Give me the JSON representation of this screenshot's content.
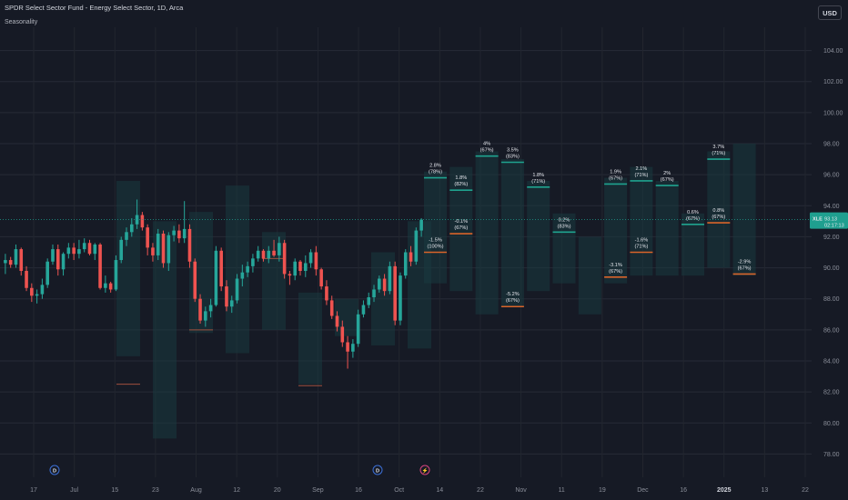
{
  "header": {
    "title": "SPDR Select Sector Fund - Energy Select Sector, 1D, Arca",
    "indicator": "Seasonality",
    "currency": "USD"
  },
  "colors": {
    "up": "#26a69a",
    "down": "#ef5350",
    "future_up": "#1fa38f",
    "future_down": "#d9642a",
    "band": "#1a3a40",
    "past_line": "#a1503e",
    "price_label_bg": "#1f9f8f"
  },
  "price_label": {
    "ticker": "XLE",
    "price": "93.13",
    "countdown": "02:17:13"
  },
  "event_markers": [
    {
      "label": "D",
      "kind": "dividend-icon"
    },
    {
      "label": "D",
      "kind": "dividend-icon"
    },
    {
      "label": "⚡",
      "kind": "earnings-icon"
    }
  ],
  "chart_data": {
    "type": "candlestick",
    "title": "SPDR Select Sector Fund - Energy Select Sector, 1D, Arca",
    "ylim": [
      76.5,
      105.5
    ],
    "y_ticks": [
      "78.00",
      "80.00",
      "82.00",
      "84.00",
      "86.00",
      "88.00",
      "90.00",
      "92.00",
      "94.00",
      "96.00",
      "98.00",
      "100.00",
      "102.00",
      "104.00"
    ],
    "x_ticks": [
      "17",
      "Jul",
      "15",
      "23",
      "Aug",
      "12",
      "20",
      "Sep",
      "16",
      "Oct",
      "14",
      "22",
      "Nov",
      "11",
      "19",
      "Dec",
      "16",
      "2025",
      "13",
      "22"
    ],
    "x_tick_bold": "2025",
    "grid": true,
    "candles": [
      [
        90.3,
        90.9,
        89.6,
        90.5
      ],
      [
        90.5,
        90.7,
        90.0,
        90.2
      ],
      [
        90.2,
        91.5,
        90.0,
        91.2
      ],
      [
        91.2,
        91.3,
        89.5,
        89.8
      ],
      [
        89.8,
        90.1,
        88.5,
        88.7
      ],
      [
        88.7,
        89.0,
        87.8,
        88.2
      ],
      [
        88.2,
        88.6,
        87.7,
        88.3
      ],
      [
        88.3,
        89.3,
        88.0,
        88.9
      ],
      [
        88.9,
        90.6,
        88.7,
        90.4
      ],
      [
        90.4,
        91.5,
        90.2,
        91.2
      ],
      [
        91.2,
        91.5,
        89.5,
        89.9
      ],
      [
        89.9,
        91.0,
        89.5,
        90.9
      ],
      [
        90.9,
        91.6,
        90.6,
        91.3
      ],
      [
        91.3,
        91.6,
        90.5,
        90.9
      ],
      [
        90.9,
        91.8,
        90.6,
        91.2
      ],
      [
        91.2,
        91.9,
        91.0,
        91.6
      ],
      [
        91.6,
        91.8,
        90.8,
        90.9
      ],
      [
        90.9,
        91.6,
        90.5,
        91.5
      ],
      [
        91.5,
        91.6,
        88.6,
        88.7
      ],
      [
        88.7,
        89.5,
        88.4,
        89.0
      ],
      [
        89.0,
        89.1,
        88.4,
        88.6
      ],
      [
        88.6,
        90.8,
        88.5,
        90.5
      ],
      [
        90.5,
        92.0,
        90.3,
        91.8
      ],
      [
        91.8,
        92.6,
        91.4,
        92.3
      ],
      [
        92.3,
        93.2,
        92.0,
        92.8
      ],
      [
        92.8,
        94.4,
        92.5,
        93.4
      ],
      [
        93.4,
        93.6,
        92.4,
        92.6
      ],
      [
        92.6,
        92.8,
        90.8,
        91.3
      ],
      [
        91.3,
        91.6,
        90.4,
        90.8
      ],
      [
        90.8,
        92.5,
        90.5,
        92.2
      ],
      [
        92.2,
        92.4,
        90.0,
        90.3
      ],
      [
        90.3,
        92.3,
        89.8,
        92.1
      ],
      [
        92.1,
        92.7,
        91.7,
        92.4
      ],
      [
        92.4,
        92.8,
        91.6,
        91.9
      ],
      [
        91.9,
        94.3,
        91.6,
        92.5
      ],
      [
        92.5,
        92.8,
        90.0,
        90.4
      ],
      [
        90.4,
        90.6,
        87.8,
        88.0
      ],
      [
        88.0,
        88.3,
        86.4,
        86.6
      ],
      [
        86.6,
        87.5,
        86.2,
        87.2
      ],
      [
        87.2,
        88.0,
        86.8,
        87.6
      ],
      [
        87.6,
        91.4,
        87.5,
        91.1
      ],
      [
        91.1,
        91.3,
        88.5,
        88.8
      ],
      [
        88.8,
        89.2,
        87.2,
        87.5
      ],
      [
        87.5,
        88.2,
        87.1,
        87.9
      ],
      [
        87.9,
        89.6,
        87.7,
        89.3
      ],
      [
        89.3,
        90.2,
        88.8,
        89.7
      ],
      [
        89.7,
        90.4,
        89.4,
        90.1
      ],
      [
        90.1,
        90.9,
        89.7,
        90.6
      ],
      [
        90.6,
        91.4,
        90.4,
        91.1
      ],
      [
        91.1,
        91.2,
        90.4,
        90.6
      ],
      [
        90.6,
        91.4,
        90.3,
        91.1
      ],
      [
        91.1,
        91.8,
        90.7,
        90.8
      ],
      [
        90.8,
        92.0,
        90.4,
        91.6
      ],
      [
        91.6,
        91.8,
        89.3,
        89.6
      ],
      [
        89.6,
        89.8,
        88.9,
        89.5
      ],
      [
        89.5,
        90.6,
        89.2,
        90.4
      ],
      [
        90.4,
        90.5,
        89.5,
        89.8
      ],
      [
        89.8,
        90.8,
        89.4,
        90.3
      ],
      [
        90.3,
        91.2,
        90.0,
        91.0
      ],
      [
        91.0,
        91.4,
        89.5,
        89.9
      ],
      [
        89.9,
        90.0,
        88.6,
        88.8
      ],
      [
        88.8,
        89.2,
        87.6,
        87.9
      ],
      [
        87.9,
        88.2,
        86.7,
        86.9
      ],
      [
        86.9,
        87.2,
        85.9,
        86.2
      ],
      [
        86.2,
        86.6,
        84.9,
        85.2
      ],
      [
        85.2,
        85.6,
        83.5,
        84.6
      ],
      [
        84.6,
        85.4,
        84.2,
        85.1
      ],
      [
        85.1,
        87.3,
        84.9,
        87.0
      ],
      [
        87.0,
        87.9,
        86.8,
        87.6
      ],
      [
        87.6,
        88.4,
        87.4,
        88.1
      ],
      [
        88.1,
        88.9,
        87.8,
        88.6
      ],
      [
        88.6,
        89.5,
        88.4,
        89.3
      ],
      [
        89.3,
        89.6,
        88.2,
        88.5
      ],
      [
        88.5,
        90.4,
        88.3,
        90.1
      ],
      [
        90.1,
        90.4,
        86.3,
        86.6
      ],
      [
        86.6,
        89.7,
        86.3,
        89.5
      ],
      [
        89.5,
        91.2,
        89.3,
        91.0
      ],
      [
        91.0,
        91.4,
        90.1,
        90.4
      ],
      [
        90.4,
        92.6,
        90.2,
        92.4
      ],
      [
        92.4,
        93.2,
        92.0,
        93.1
      ]
    ],
    "future_candles": [
      [
        87.8,
        88.6,
        87.2,
        88.2
      ],
      [
        86.1,
        86.5,
        84.9,
        85.4
      ],
      [
        88.0,
        89.8,
        86.7,
        88.9
      ]
    ],
    "seasonal_bars": [
      {
        "low": 84.3,
        "high": 95.6,
        "base": 82.5,
        "up": false
      },
      {
        "low": 79.0,
        "high": 93.0,
        "base": null,
        "up": true
      },
      {
        "low": 85.8,
        "high": 93.6,
        "base": 86.0,
        "up": false
      },
      {
        "low": 84.5,
        "high": 95.3,
        "base": null,
        "up": true
      },
      {
        "low": 86.0,
        "high": 92.3,
        "base": 90.6,
        "up": false
      },
      {
        "low": 82.5,
        "high": 88.4,
        "base": 82.4,
        "up": false
      },
      {
        "low": 85.6,
        "high": 88.0,
        "base": null,
        "up": true
      },
      {
        "low": 85.0,
        "high": 91.0,
        "base": null,
        "up": true
      },
      {
        "low": 84.8,
        "high": 93.0,
        "base": null,
        "up": true
      }
    ],
    "projections": [
      {
        "up": "2.8%",
        "up_pct": "(78%)",
        "up_level": 95.8,
        "down": "-1.5%",
        "down_pct": "(100%)",
        "down_level": 91.0,
        "band": [
          89.0,
          96.2
        ]
      },
      {
        "up": "1.8%",
        "up_pct": "(82%)",
        "up_level": 95.0,
        "down": "-0.1%",
        "down_pct": "(67%)",
        "down_level": 92.2,
        "band": [
          88.5,
          96.5
        ]
      },
      {
        "up": "4%",
        "up_pct": "(67%)",
        "up_level": 97.2,
        "down": null,
        "down_pct": null,
        "down_level": null,
        "band": [
          87.0,
          97.5
        ]
      },
      {
        "up": "3.5%",
        "up_pct": "(83%)",
        "up_level": 96.8,
        "down": "-5.2%",
        "down_pct": "(67%)",
        "down_level": 87.5,
        "band": [
          87.5,
          97.0
        ]
      },
      {
        "up": "1.8%",
        "up_pct": "(71%)",
        "up_level": 95.2,
        "down": null,
        "down_pct": null,
        "down_level": null,
        "band": [
          88.5,
          95.6
        ]
      },
      {
        "up": "0.2%",
        "up_pct": "(83%)",
        "up_level": 92.3,
        "down": null,
        "down_pct": null,
        "down_level": null,
        "band": [
          89.0,
          93.5
        ]
      },
      {
        "up": null,
        "up_pct": null,
        "up_level": null,
        "down": null,
        "down_pct": null,
        "down_level": null,
        "band": [
          87.0,
          92.0
        ]
      },
      {
        "up": "1.9%",
        "up_pct": "(67%)",
        "up_level": 95.4,
        "down": "-3.1%",
        "down_pct": "(67%)",
        "down_level": 89.4,
        "band": [
          89.0,
          95.8
        ]
      },
      {
        "up": "2.1%",
        "up_pct": "(71%)",
        "up_level": 95.6,
        "down": "-1.6%",
        "down_pct": "(71%)",
        "down_level": 91.0,
        "band": [
          89.5,
          96.5
        ]
      },
      {
        "up": "2%",
        "up_pct": "(67%)",
        "up_level": 95.3,
        "down": null,
        "down_pct": null,
        "down_level": null,
        "band": [
          89.5,
          95.6
        ]
      },
      {
        "up": "0.6%",
        "up_pct": "(67%)",
        "up_level": 92.8,
        "down": null,
        "down_pct": null,
        "down_level": null,
        "band": [
          89.5,
          93.5
        ]
      },
      {
        "up": "3.7%",
        "up_pct": "(71%)",
        "up_level": 97.0,
        "down": "0.8%",
        "down_pct": "(67%)",
        "down_level": 92.9,
        "band": [
          90.0,
          97.5
        ]
      },
      {
        "up": null,
        "up_pct": null,
        "up_level": null,
        "down": "-2.9%",
        "down_pct": "(67%)",
        "down_level": 89.6,
        "band": [
          89.5,
          98.0
        ]
      }
    ]
  }
}
